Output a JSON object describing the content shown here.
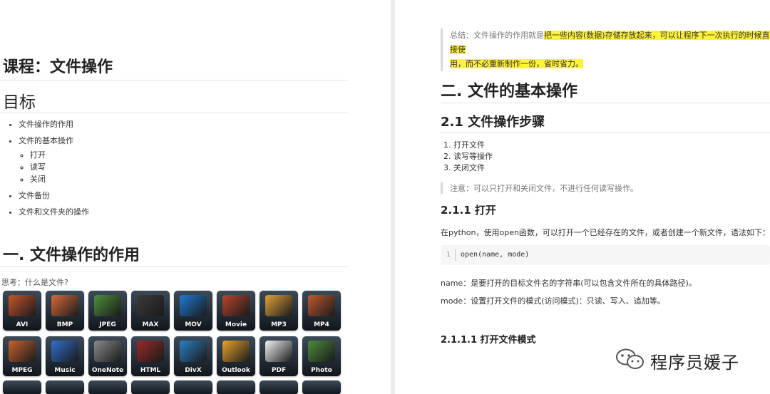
{
  "left": {
    "course_title": "课程：文件操作",
    "goals_heading": "目标",
    "goals": [
      {
        "label": "文件操作的作用"
      },
      {
        "label": "文件的基本操作",
        "children": [
          "打开",
          "读写",
          "关闭"
        ]
      },
      {
        "label": "文件备份"
      },
      {
        "label": "文件和文件夹的操作"
      }
    ],
    "section1_heading": "一. 文件操作的作用",
    "think_text": "思考：什么是文件?",
    "file_tiles": [
      {
        "label": "AVI",
        "color": "#c8552a"
      },
      {
        "label": "BMP",
        "color": "#d96a3c"
      },
      {
        "label": "JPEG",
        "color": "#4f8f3a"
      },
      {
        "label": "MAX",
        "color": "#3b3b3b"
      },
      {
        "label": "MOV",
        "color": "#1f7ad6"
      },
      {
        "label": "Movie",
        "color": "#b8442b"
      },
      {
        "label": "MP3",
        "color": "#e0a23a"
      },
      {
        "label": "MP4",
        "color": "#c0582f"
      },
      {
        "label": "MPEG",
        "color": "#c9622e"
      },
      {
        "label": "Music",
        "color": "#2f6fd0"
      },
      {
        "label": "OneNote",
        "color": "#8a8a8a"
      },
      {
        "label": "HTML",
        "color": "#9a2a2a"
      },
      {
        "label": "DivX",
        "color": "#2a7fc4"
      },
      {
        "label": "Outlook",
        "color": "#e7a42d"
      },
      {
        "label": "PDF",
        "color": "#f2f2f2"
      },
      {
        "label": "Photo",
        "color": "#4d8a3c"
      }
    ]
  },
  "right": {
    "summary_prefix": "总结：文件操作的作用就是",
    "summary_highlight_1": "把一些内容(数据)存储存放起来，可以让程序下一次执行的时候直接使",
    "summary_highlight_2": "用，而不必重新制作一份，省时省力。",
    "section2_heading": "二. 文件的基本操作",
    "sub21_heading": "2.1 文件操作步骤",
    "steps": [
      "打开文件",
      "读写等操作",
      "关闭文件"
    ],
    "note": "注意：可以只打开和关闭文件，不进行任何读写操作。",
    "sub211_heading": "2.1.1 打开",
    "open_intro": "在python，使用open函数，可以打开一个已经存在的文件，或者创建一个新文件，语法如下：",
    "code_line_number": "1",
    "code": "open(name, mode)",
    "name_desc": "name：是要打开的目标文件名的字符串(可以包含文件所在的具体路径)。",
    "mode_desc": "mode：设置打开文件的模式(访问模式)：只读、写入、追加等。",
    "sub2111_heading": "2.1.1.1 打开文件模式"
  },
  "watermark": {
    "text": "程序员媛子",
    "icon": "wechat-icon"
  }
}
